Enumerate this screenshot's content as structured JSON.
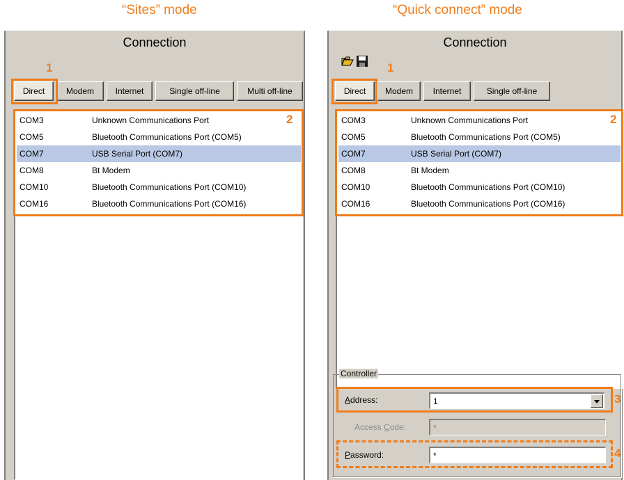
{
  "titles": {
    "sites_mode": "“Sites” mode",
    "quick_mode": "“Quick connect” mode"
  },
  "panel_title": "Connection",
  "callouts": {
    "one": "1",
    "two": "2",
    "three": "3",
    "four": "4"
  },
  "left_tabs": [
    "Direct",
    "Modem",
    "Internet",
    "Single off-line",
    "Multi off-line"
  ],
  "right_tabs": [
    "Direct",
    "Modem",
    "Internet",
    "Single off-line"
  ],
  "ports": [
    {
      "port": "COM3",
      "desc": "Unknown Communications Port"
    },
    {
      "port": "COM5",
      "desc": "Bluetooth Communications Port (COM5)"
    },
    {
      "port": "COM7",
      "desc": "USB Serial Port (COM7)"
    },
    {
      "port": "COM8",
      "desc": "Bt Modem"
    },
    {
      "port": "COM10",
      "desc": "Bluetooth Communications Port (COM10)"
    },
    {
      "port": "COM16",
      "desc": "Bluetooth Communications Port (COM16)"
    }
  ],
  "selected_port_index": 2,
  "controller": {
    "group_label": "Controller",
    "address_label_first": "A",
    "address_label_rest": "ddress:",
    "address_value": "1",
    "access_label_pre": "Access ",
    "access_label_ul": "C",
    "access_label_post": "ode:",
    "access_value": "*",
    "password_label_first": "P",
    "password_label_rest": "assword:",
    "password_value": "*"
  },
  "colors": {
    "highlight": "#f07c1a",
    "panel_bg": "#d4d0c8",
    "selection": "#b9c9e5"
  },
  "icons": [
    "open-folder-icon",
    "save-disk-icon"
  ]
}
